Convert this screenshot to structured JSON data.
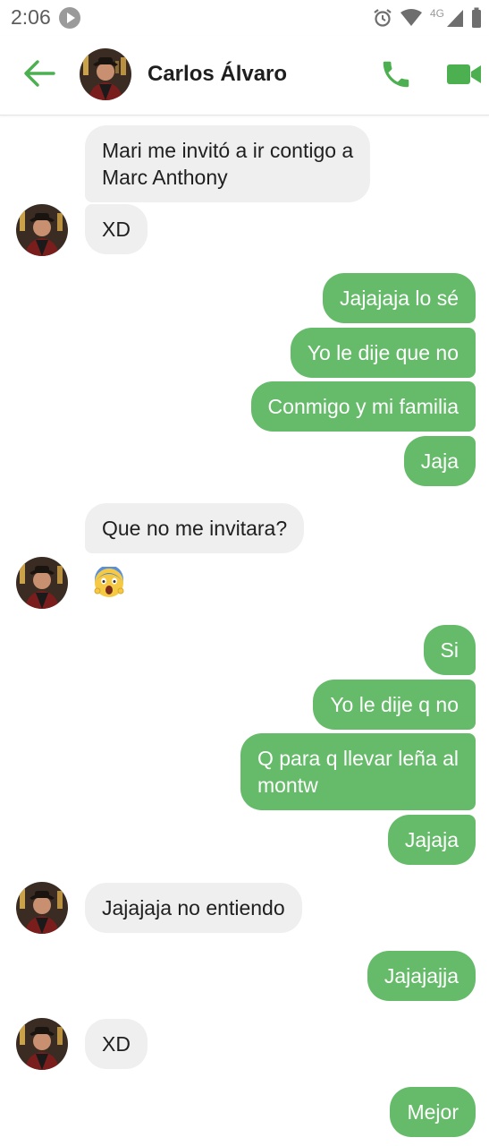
{
  "status_bar": {
    "time": "2:06",
    "network": "4G"
  },
  "contact": {
    "name": "Carlos Álvaro"
  },
  "colors": {
    "accent": "#4caf50",
    "outgoing_bubble": "#66bb6a",
    "incoming_bubble": "#efefef"
  },
  "messages": [
    {
      "dir": "in",
      "text": "Mari me invitó a ir contigo a\nMarc Anthony"
    },
    {
      "dir": "in",
      "text": "XD"
    },
    {
      "dir": "out",
      "text": "Jajajaja lo sé"
    },
    {
      "dir": "out",
      "text": "Yo le dije que no"
    },
    {
      "dir": "out",
      "text": "Conmigo y mi familia"
    },
    {
      "dir": "out",
      "text": "Jaja"
    },
    {
      "dir": "in",
      "text": "Que no me invitara?"
    },
    {
      "dir": "in",
      "emoji": "face-screaming-in-fear"
    },
    {
      "dir": "out",
      "text": "Si"
    },
    {
      "dir": "out",
      "text": "Yo le dije q no"
    },
    {
      "dir": "out",
      "text": "Q para q llevar leña al\nmontw"
    },
    {
      "dir": "out",
      "text": "Jajaja"
    },
    {
      "dir": "in",
      "text": "Jajajaja no entiendo"
    },
    {
      "dir": "out",
      "text": "Jajajajja"
    },
    {
      "dir": "in",
      "text": "XD"
    },
    {
      "dir": "out",
      "text": "Mejor"
    }
  ]
}
